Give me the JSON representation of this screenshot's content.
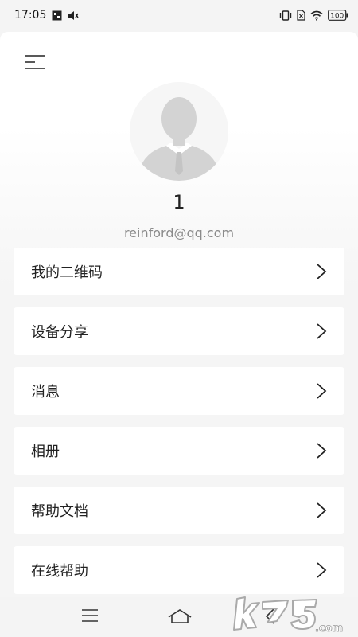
{
  "status_bar": {
    "time": "17:05",
    "battery": "100",
    "icons": [
      "app-notification-icon",
      "mute-icon",
      "vibrate-icon",
      "no-sim-icon",
      "wifi-icon",
      "battery-icon"
    ]
  },
  "header": {
    "menu_icon": "hamburger-menu-icon"
  },
  "profile": {
    "username": "1",
    "email": "reinford@qq.com"
  },
  "menu": {
    "items": [
      {
        "label": "我的二维码"
      },
      {
        "label": "设备分享"
      },
      {
        "label": "消息"
      },
      {
        "label": "相册"
      },
      {
        "label": "帮助文档"
      },
      {
        "label": "在线帮助"
      }
    ]
  },
  "nav": {
    "icons": [
      "recents-icon",
      "home-icon",
      "back-icon"
    ]
  },
  "watermark": {
    "text": "k73.com"
  },
  "colors": {
    "background": "#f4f4f4",
    "card": "#ffffff",
    "text": "#222222",
    "muted": "#8a8a8a"
  }
}
